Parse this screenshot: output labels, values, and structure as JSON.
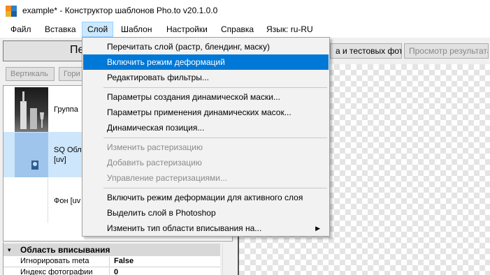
{
  "window": {
    "title": "example* - Конструктор шаблонов Pho.to v20.1.0.0"
  },
  "menubar": {
    "items": [
      "Файл",
      "Вставка",
      "Слой",
      "Шаблон",
      "Настройки",
      "Справка",
      "Язык: ru-RU"
    ],
    "active": "Слой"
  },
  "toolbar": {
    "primary_label": "Пе",
    "test_photos_label": "а и тестовых фото",
    "preview_label": "Просмотр результата",
    "vertical_label": "Вертикаль",
    "horizontal_label": "Гори"
  },
  "layers": [
    {
      "label": "Группа",
      "selected": false
    },
    {
      "label": "SQ Обла",
      "sublabel": "[uv]",
      "selected": true
    },
    {
      "label": "Фон [uv",
      "selected": false
    }
  ],
  "properties": {
    "header": "Область вписывания",
    "rows": [
      {
        "name": "Игнорировать meta",
        "value": "False"
      },
      {
        "name": "Индекс фотографии",
        "value": "0"
      }
    ]
  },
  "dropdown": {
    "groups": [
      [
        {
          "label": "Перечитать слой (растр, блендинг, маску)",
          "state": "normal"
        },
        {
          "label": "Включить режим деформаций",
          "state": "highlight"
        },
        {
          "label": "Редактировать фильтры...",
          "state": "normal"
        }
      ],
      [
        {
          "label": "Параметры создания динамической маски...",
          "state": "normal"
        },
        {
          "label": "Параметры применения динамических масок...",
          "state": "normal"
        },
        {
          "label": "Динамическая позиция...",
          "state": "normal"
        }
      ],
      [
        {
          "label": "Изменить растеризацию",
          "state": "disabled"
        },
        {
          "label": "Добавить растеризацию",
          "state": "disabled"
        },
        {
          "label": "Управление растеризациями...",
          "state": "disabled"
        }
      ],
      [
        {
          "label": "Включить режим деформации для активного слоя",
          "state": "normal"
        },
        {
          "label": "Выделить слой в Photoshop",
          "state": "normal"
        },
        {
          "label": "Изменить тип области вписывания на...",
          "state": "normal",
          "submenu": true
        }
      ]
    ]
  },
  "colors": {
    "highlight": "#0078d7",
    "menu_active": "#cce8ff",
    "selection": "#9fc5ec"
  }
}
